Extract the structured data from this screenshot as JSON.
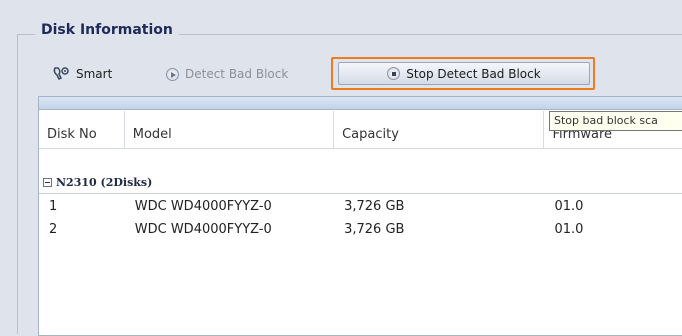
{
  "panel": {
    "title": "Disk Information"
  },
  "toolbar": {
    "smart_label": "Smart",
    "detect_label": "Detect Bad Block",
    "stop_label": "Stop Detect Bad Block"
  },
  "tooltip": {
    "text": "Stop bad block sca"
  },
  "grid": {
    "columns": [
      "Disk No",
      "Model",
      "Capacity",
      "Firmware"
    ],
    "group": "N2310 (2Disks)",
    "rows": [
      {
        "disk_no": "1",
        "model": "WDC WD4000FYYZ-0",
        "capacity": "3,726 GB",
        "firmware": "01.0"
      },
      {
        "disk_no": "2",
        "model": "WDC WD4000FYYZ-0",
        "capacity": "3,726 GB",
        "firmware": "01.0"
      }
    ]
  },
  "colors": {
    "highlight": "#f07a1e",
    "background": "#dfe4ec"
  }
}
